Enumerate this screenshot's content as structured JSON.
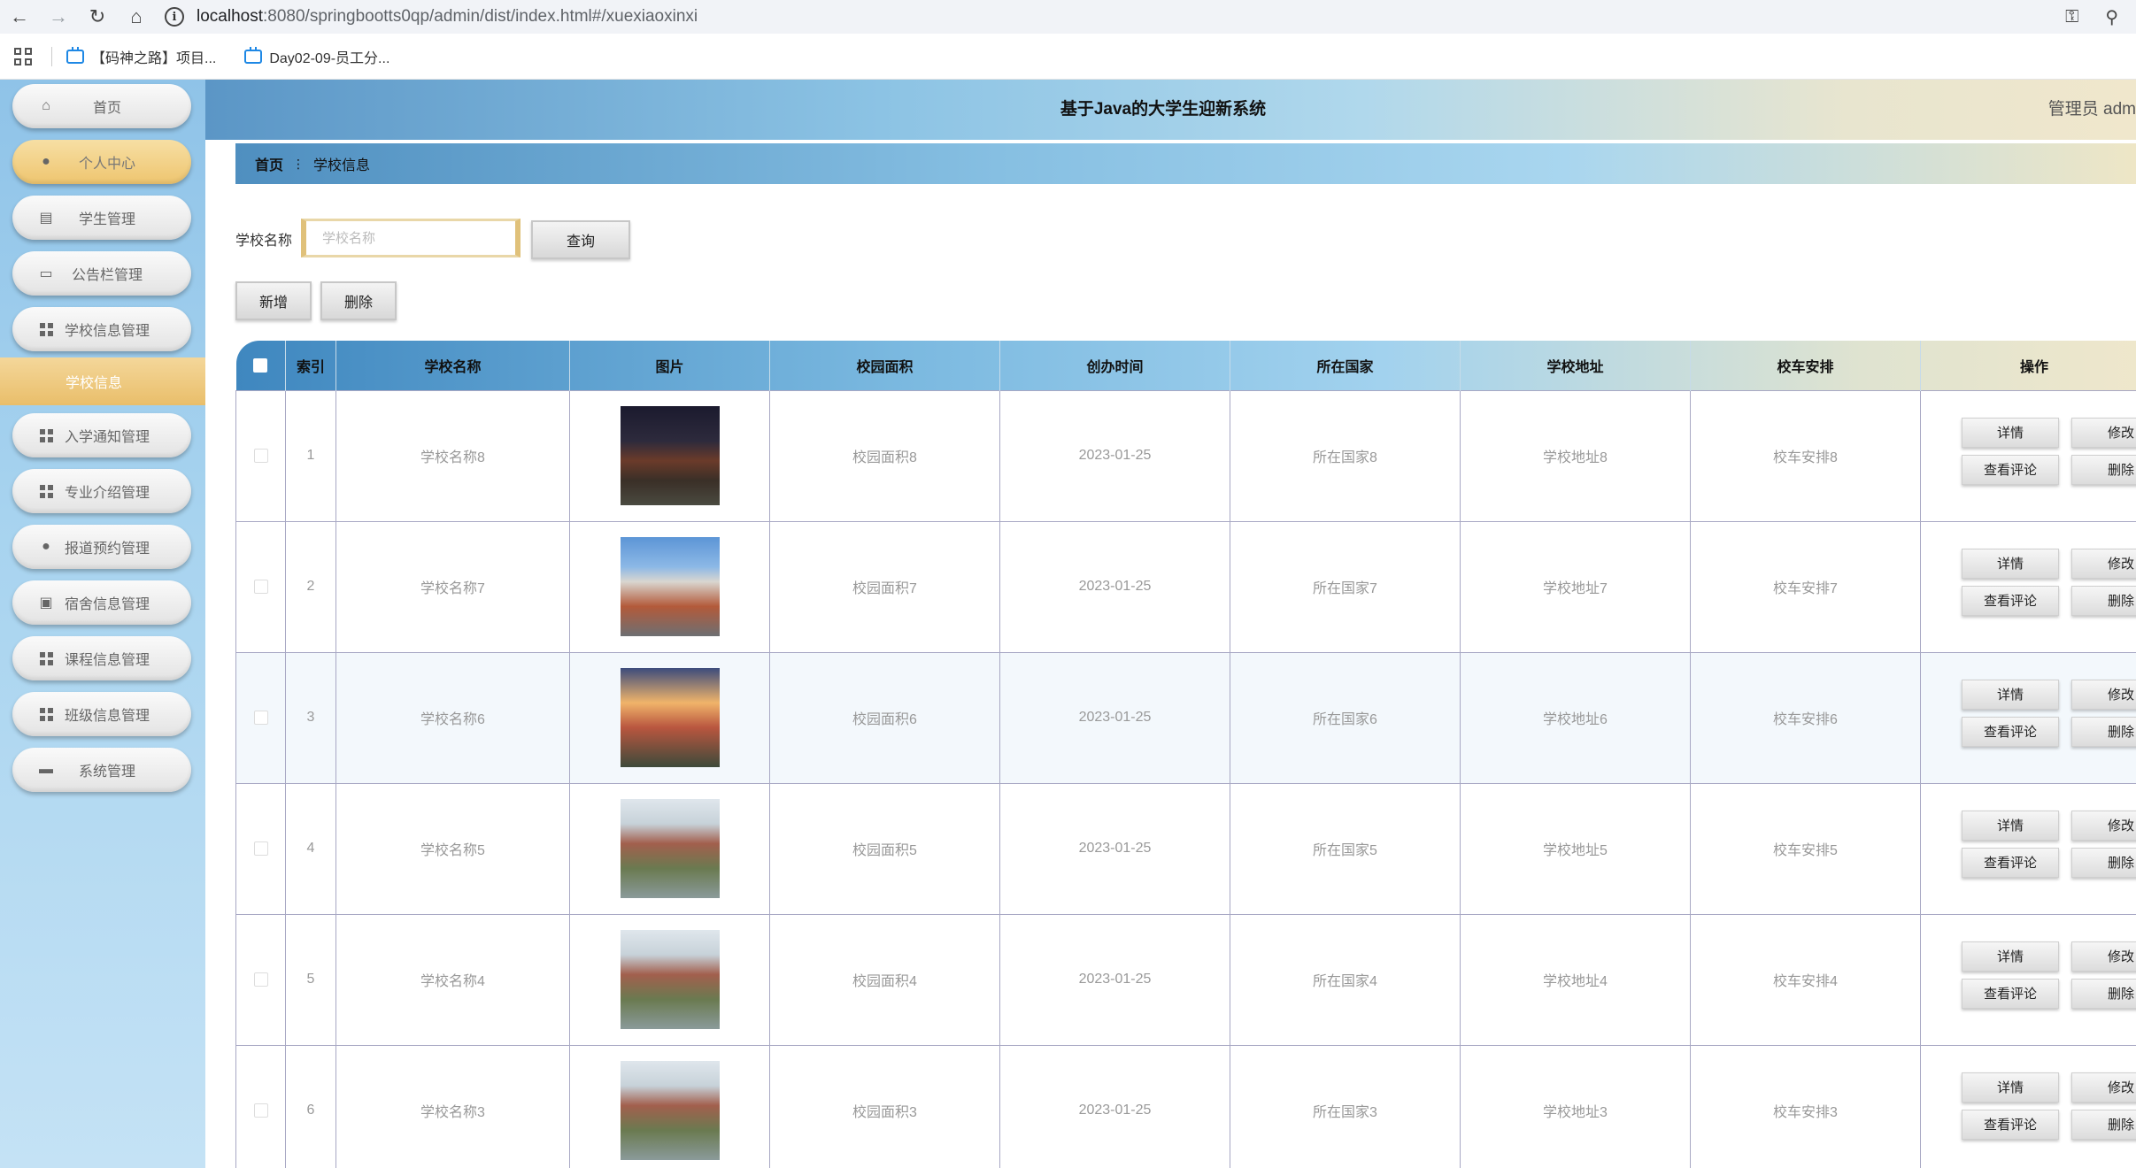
{
  "browser": {
    "url_host": "localhost",
    "url_path": ":8080/springbootts0qp/admin/dist/index.html#/xuexiaoxinxi",
    "bookmarks": [
      "【码神之路】项目...",
      "Day02-09-员工分..."
    ]
  },
  "header": {
    "title": "基于Java的大学生迎新系统",
    "user": "管理员 adm"
  },
  "sidebar": {
    "items": [
      {
        "label": "首页",
        "icon": "home-icon"
      },
      {
        "label": "个人中心",
        "icon": "user-icon"
      },
      {
        "label": "学生管理",
        "icon": "chart-icon"
      },
      {
        "label": "公告栏管理",
        "icon": "monitor-icon"
      },
      {
        "label": "学校信息管理",
        "icon": "grid-icon"
      },
      {
        "label": "入学通知管理",
        "icon": "grid-icon"
      },
      {
        "label": "专业介绍管理",
        "icon": "grid-icon"
      },
      {
        "label": "报道预约管理",
        "icon": "user-icon"
      },
      {
        "label": "宿舍信息管理",
        "icon": "clipboard-icon"
      },
      {
        "label": "课程信息管理",
        "icon": "grid-icon"
      },
      {
        "label": "班级信息管理",
        "icon": "grid-icon"
      },
      {
        "label": "系统管理",
        "icon": "briefcase-icon"
      }
    ],
    "active_sub": "学校信息"
  },
  "breadcrumb": {
    "home": "首页",
    "current": "学校信息"
  },
  "search": {
    "label": "学校名称",
    "placeholder": "学校名称",
    "query_button": "查询"
  },
  "actions": {
    "add": "新增",
    "delete": "删除"
  },
  "table": {
    "columns": [
      "索引",
      "学校名称",
      "图片",
      "校园面积",
      "创办时间",
      "所在国家",
      "学校地址",
      "校车安排",
      "操作"
    ],
    "row_buttons": {
      "detail": "详情",
      "edit": "修改",
      "comment": "查看评论",
      "delete": "删除"
    },
    "rows": [
      {
        "index": "1",
        "name": "学校名称8",
        "area": "校园面积8",
        "date": "2023-01-25",
        "country": "所在国家8",
        "address": "学校地址8",
        "bus": "校车安排8"
      },
      {
        "index": "2",
        "name": "学校名称7",
        "area": "校园面积7",
        "date": "2023-01-25",
        "country": "所在国家7",
        "address": "学校地址7",
        "bus": "校车安排7"
      },
      {
        "index": "3",
        "name": "学校名称6",
        "area": "校园面积6",
        "date": "2023-01-25",
        "country": "所在国家6",
        "address": "学校地址6",
        "bus": "校车安排6"
      },
      {
        "index": "4",
        "name": "学校名称5",
        "area": "校园面积5",
        "date": "2023-01-25",
        "country": "所在国家5",
        "address": "学校地址5",
        "bus": "校车安排5"
      },
      {
        "index": "5",
        "name": "学校名称4",
        "area": "校园面积4",
        "date": "2023-01-25",
        "country": "所在国家4",
        "address": "学校地址4",
        "bus": "校车安排4"
      },
      {
        "index": "6",
        "name": "学校名称3",
        "area": "校园面积3",
        "date": "2023-01-25",
        "country": "所在国家3",
        "address": "学校地址3",
        "bus": "校车安排3"
      }
    ]
  }
}
